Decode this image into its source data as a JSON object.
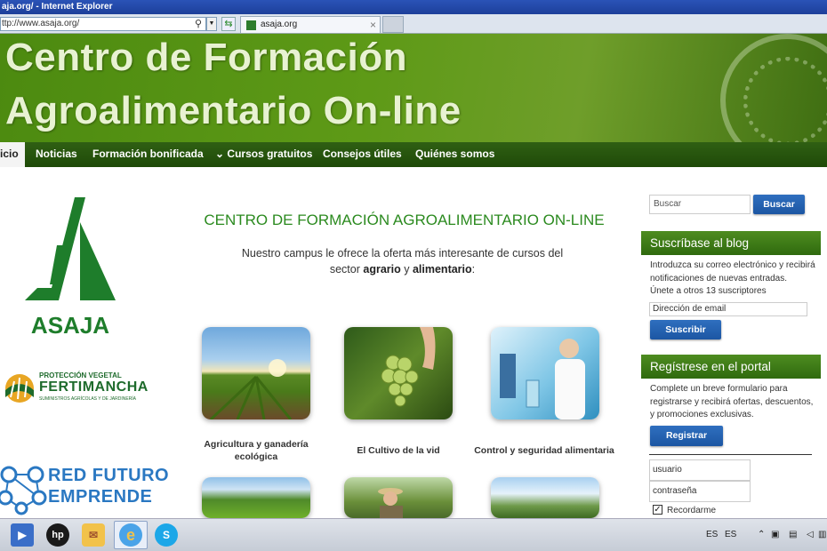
{
  "browser": {
    "title": "aja.org/ - Internet Explorer",
    "address": "ttp://www.asaja.org/",
    "tab_title": "asaja.org"
  },
  "banner": {
    "line1": "Centro de Formación",
    "line2": "Agroalimentario On-line"
  },
  "nav": {
    "items": [
      "icio",
      "Noticias",
      "Formación bonificada",
      "Cursos gratuitos",
      "Consejos útiles",
      "Quiénes somos"
    ]
  },
  "logos": {
    "asaja": "ASAJA",
    "fertimancha_top": "PROTECCIÓN VEGETAL",
    "fertimancha": "FERTIMANCHA",
    "fertimancha_sub": "SUMINISTROS AGRÍCOLAS Y DE JARDINERÍA",
    "red_line1": "RED FUTURO",
    "red_line2": "EMPRENDE"
  },
  "main": {
    "title": "CENTRO DE FORMACIÓN AGROALIMENTARIO ON-LINE",
    "intro_1": "Nuestro campus le ofrece la oferta más interesante de cursos del",
    "intro_2a": "sector ",
    "intro_2b": "agrario",
    "intro_2c": " y ",
    "intro_2d": "alimentario",
    "intro_2e": ":",
    "courses": [
      "Agricultura y ganadería ecológica",
      "El Cultivo de la vid",
      "Control y seguridad alimentaria"
    ]
  },
  "sidebar": {
    "search_placeholder": "Buscar",
    "search_button": "Buscar",
    "blog_title": "Suscríbase al blog",
    "blog_text": "Introduzca su correo electrónico y recibirá notificaciones de nuevas entradas.",
    "blog_join": "Únete a otros 13 suscriptores",
    "email_placeholder": "Dirección de email",
    "subscribe_button": "Suscribir",
    "register_title": "Regístrese en el portal",
    "register_text": "Complete un breve formulario para registrarse y recibirá ofertas, descuentos, y promociones exclusivas.",
    "register_button": "Registrar",
    "user_placeholder": "usuario",
    "pass_placeholder": "contraseña",
    "remember": "Recordarme"
  },
  "taskbar": {
    "lang1": "ES",
    "lang2": "ES"
  }
}
